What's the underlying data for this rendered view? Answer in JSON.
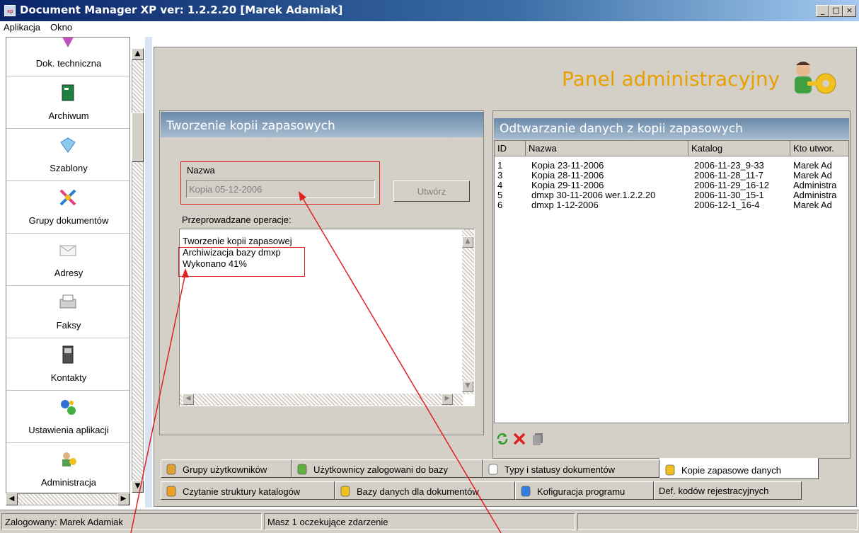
{
  "window": {
    "title": "Document Manager XP ver: 1.2.2.20  [Marek Adamiak]",
    "minimize": "_",
    "maximize": "□",
    "close": "×"
  },
  "menu": {
    "items": [
      "Aplikacja",
      "Okno"
    ]
  },
  "sidebar": {
    "items": [
      {
        "label": "Dok. techniczna",
        "icon": "pen-icon"
      },
      {
        "label": "Archiwum",
        "icon": "book-icon"
      },
      {
        "label": "Szablony",
        "icon": "template-icon"
      },
      {
        "label": "Grupy dokumentów",
        "icon": "groups-icon"
      },
      {
        "label": "Adresy",
        "icon": "envelope-icon"
      },
      {
        "label": "Faksy",
        "icon": "fax-icon"
      },
      {
        "label": "Kontakty",
        "icon": "phone-icon"
      },
      {
        "label": "Ustawienia aplikacji",
        "icon": "gears-icon"
      },
      {
        "label": "Administracja",
        "icon": "admin-key-icon"
      }
    ]
  },
  "admin_panel": {
    "title": "Panel administracyjny"
  },
  "backup": {
    "header": "Tworzenie kopii zapasowych",
    "name_label": "Nazwa",
    "name_value": "Kopia 05-12-2006",
    "create_button": "Utwórz",
    "ops_label": "Przeprowadzane operacje:",
    "ops_lines": [
      "Tworzenie kopii zapasowej",
      "Archiwizacja bazy dmxp",
      "Wykonano 41%"
    ]
  },
  "restore": {
    "header": "Odtwarzanie danych z kopii zapasowych",
    "columns": [
      "ID",
      "Nazwa",
      "Katalog",
      "Kto utwor."
    ],
    "rows": [
      [
        "1",
        "Kopia 23-11-2006",
        "2006-11-23_9-33",
        "Marek Ad"
      ],
      [
        "3",
        "Kopia 28-11-2006",
        "2006-11-28_11-7",
        "Marek Ad"
      ],
      [
        "4",
        "Kopia 29-11-2006",
        "2006-11-29_16-12",
        "Administra"
      ],
      [
        "5",
        "dmxp 30-11-2006 wer.1.2.2.20",
        "2006-11-30_15-1",
        "Administra"
      ],
      [
        "6",
        "dmxp 1-12-2006",
        "2006-12-1_16-4",
        "Marek Ad"
      ]
    ]
  },
  "tabs": {
    "row1": [
      {
        "label": "Grupy użytkowników",
        "icon": "users-icon"
      },
      {
        "label": "Użytkownicy zalogowani do bazy",
        "icon": "user-green-icon"
      },
      {
        "label": "Typy i statusy dokumentów",
        "icon": "document-icon"
      },
      {
        "label": "Kopie zapasowe danych",
        "icon": "database-icon"
      }
    ],
    "row2": [
      {
        "label": "Czytanie struktury katalogów",
        "icon": "folders-icon"
      },
      {
        "label": "Bazy danych dla dokumentów",
        "icon": "database-icon"
      },
      {
        "label": "Kofiguracja programu",
        "icon": "config-icon"
      },
      {
        "label": "Def. kodów rejestracyjnych",
        "icon": ""
      }
    ]
  },
  "status": {
    "user": "Zalogowany: Marek Adamiak",
    "events": "Masz 1 oczekujące zdarzenie"
  },
  "colors": {
    "accent": "#e8a000",
    "annotation": "#e02020",
    "section_header": "#7a96b4"
  }
}
